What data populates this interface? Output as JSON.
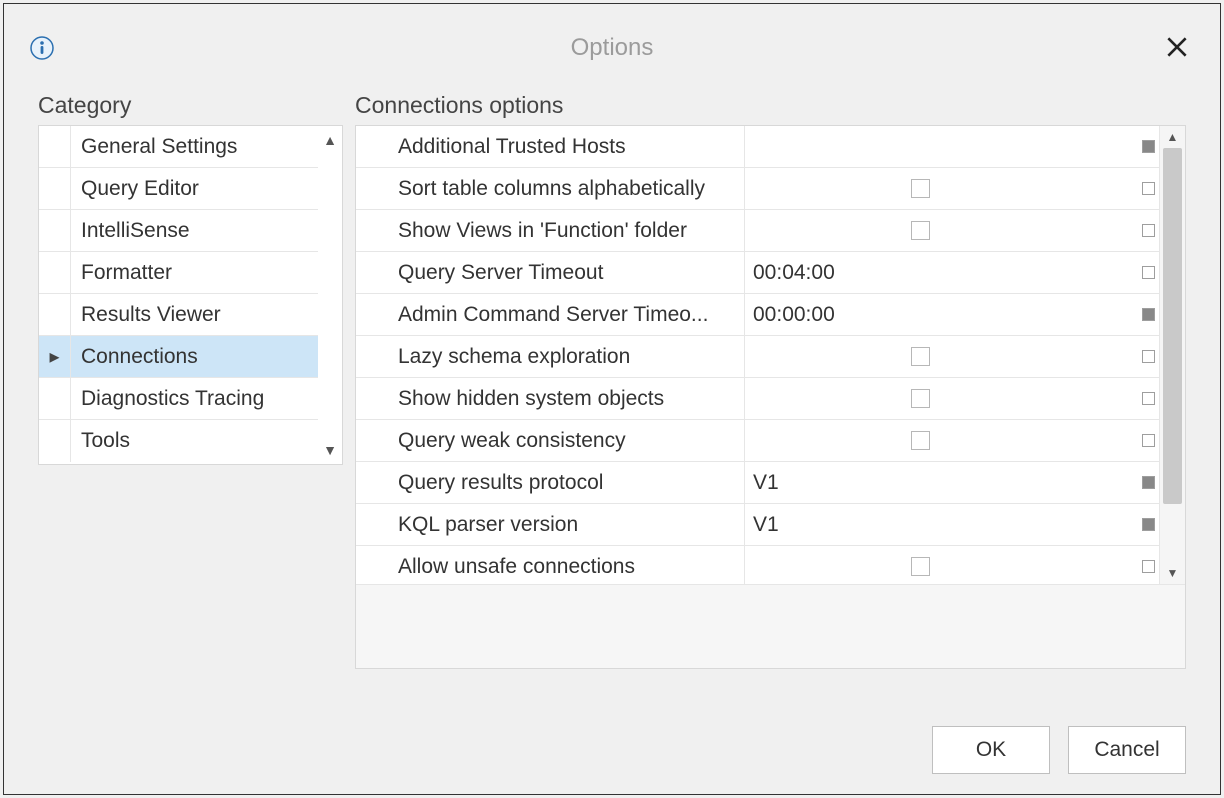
{
  "dialog": {
    "title": "Options"
  },
  "categoryHeader": "Category",
  "categories": [
    {
      "label": "General Settings",
      "selected": false
    },
    {
      "label": "Query Editor",
      "selected": false
    },
    {
      "label": "IntelliSense",
      "selected": false
    },
    {
      "label": "Formatter",
      "selected": false
    },
    {
      "label": "Results Viewer",
      "selected": false
    },
    {
      "label": "Connections",
      "selected": true
    },
    {
      "label": "Diagnostics Tracing",
      "selected": false
    },
    {
      "label": "Tools",
      "selected": false
    }
  ],
  "optionsHeader": "Connections options",
  "options": [
    {
      "name": "Additional Trusted Hosts",
      "type": "text",
      "value": "",
      "resetFilled": true
    },
    {
      "name": "Sort table columns alphabetically",
      "type": "check",
      "checked": false,
      "resetFilled": false
    },
    {
      "name": "Show Views in 'Function' folder",
      "type": "check",
      "checked": false,
      "resetFilled": false
    },
    {
      "name": "Query Server Timeout",
      "type": "text",
      "value": "00:04:00",
      "resetFilled": false
    },
    {
      "name": "Admin Command Server Timeo...",
      "type": "text",
      "value": "00:00:00",
      "resetFilled": true
    },
    {
      "name": "Lazy schema exploration",
      "type": "check",
      "checked": false,
      "resetFilled": false
    },
    {
      "name": "Show hidden system objects",
      "type": "check",
      "checked": false,
      "resetFilled": false
    },
    {
      "name": "Query weak consistency",
      "type": "check",
      "checked": false,
      "resetFilled": false
    },
    {
      "name": "Query results protocol",
      "type": "text",
      "value": "V1",
      "resetFilled": true
    },
    {
      "name": "KQL parser version",
      "type": "text",
      "value": "V1",
      "resetFilled": true
    },
    {
      "name": "Allow unsafe connections",
      "type": "check",
      "checked": false,
      "resetFilled": false
    }
  ],
  "buttons": {
    "ok": "OK",
    "cancel": "Cancel"
  }
}
